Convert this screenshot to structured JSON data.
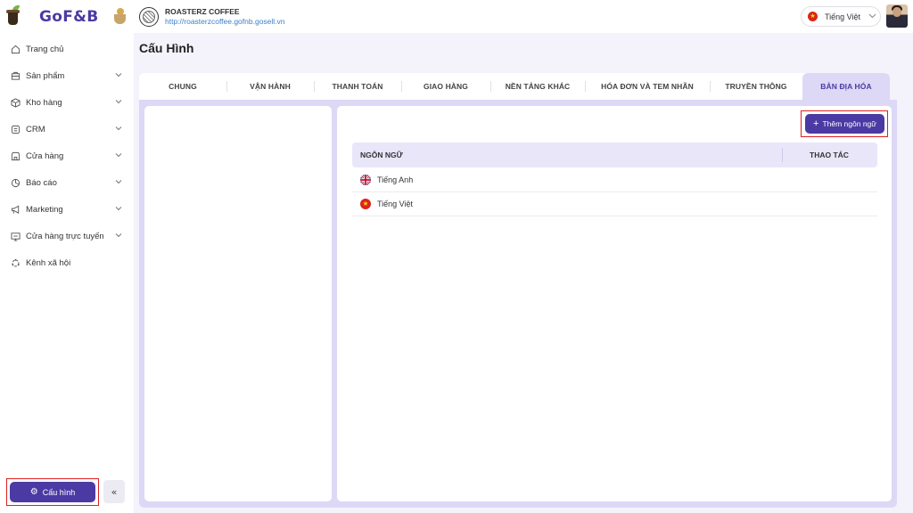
{
  "header": {
    "logo_text": "GoF&B",
    "store_name": "ROASTERZ COFFEE",
    "store_url": "http://roasterzcoffee.gofnb.gosell.vn",
    "language": "Tiếng Việt"
  },
  "sidebar": {
    "items": [
      {
        "label": "Trang chủ",
        "icon": "home-icon",
        "has_chevron": false
      },
      {
        "label": "Sản phẩm",
        "icon": "product-icon",
        "has_chevron": true
      },
      {
        "label": "Kho hàng",
        "icon": "box-icon",
        "has_chevron": true
      },
      {
        "label": "CRM",
        "icon": "crm-icon",
        "has_chevron": true
      },
      {
        "label": "Cửa hàng",
        "icon": "store-icon",
        "has_chevron": true
      },
      {
        "label": "Báo cáo",
        "icon": "report-icon",
        "has_chevron": true
      },
      {
        "label": "Marketing",
        "icon": "megaphone-icon",
        "has_chevron": true
      },
      {
        "label": "Cửa hàng trực tuyến",
        "icon": "online-store-icon",
        "has_chevron": true
      },
      {
        "label": "Kênh xã hội",
        "icon": "social-icon",
        "has_chevron": false
      }
    ],
    "config_label": "Cấu hình",
    "collapse_glyph": "«"
  },
  "main": {
    "page_title": "Cấu Hình",
    "tabs": [
      {
        "label": "CHUNG",
        "active": false
      },
      {
        "label": "VẬN HÀNH",
        "active": false
      },
      {
        "label": "THANH TOÁN",
        "active": false
      },
      {
        "label": "GIAO HÀNG",
        "active": false
      },
      {
        "label": "NỀN TẢNG KHÁC",
        "active": false
      },
      {
        "label": "HÓA ĐƠN VÀ TEM NHÃN",
        "active": false
      },
      {
        "label": "TRUYỀN THÔNG",
        "active": false
      },
      {
        "label": "BẢN ĐỊA HÓA",
        "active": true
      }
    ],
    "add_language_label": "Thêm ngôn ngữ",
    "table": {
      "columns": [
        "NGÔN NGỮ",
        "THAO TÁC"
      ],
      "rows": [
        {
          "language": "Tiếng Anh",
          "flag": "uk-flag-icon"
        },
        {
          "language": "Tiếng Việt",
          "flag": "vn-flag-icon"
        }
      ]
    }
  },
  "colors": {
    "brand": "#4b3aa3",
    "tab_active_bg": "#dcd8f6",
    "highlight": "#e02020"
  }
}
